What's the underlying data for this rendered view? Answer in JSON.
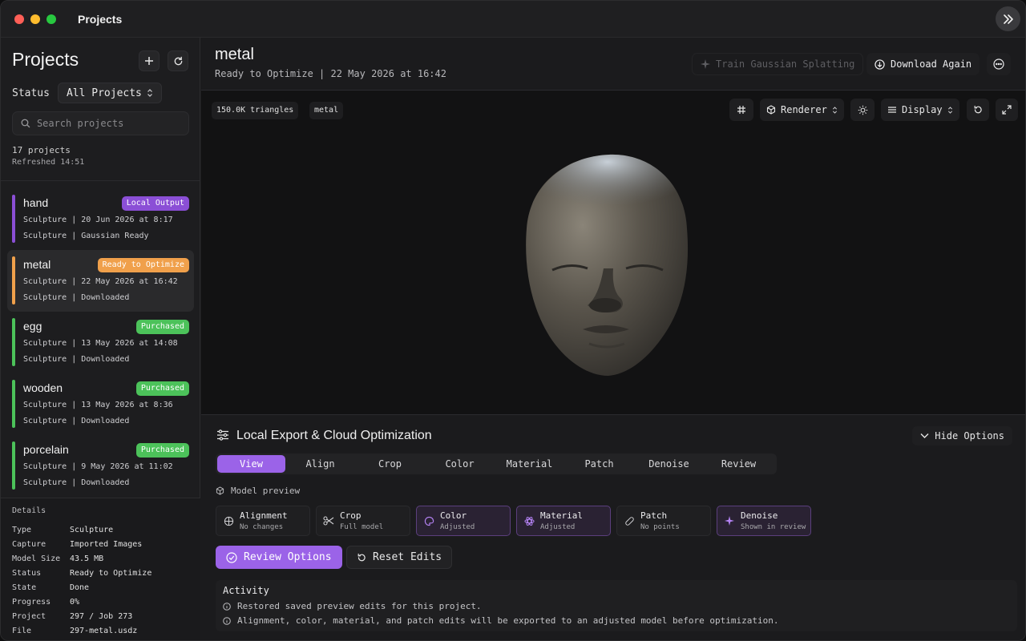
{
  "window": {
    "title": "Projects"
  },
  "sidebar": {
    "title": "Projects",
    "status_label": "Status",
    "status_value": "All Projects",
    "search_placeholder": "Search projects",
    "count": "17 projects",
    "refreshed": "Refreshed 14:51",
    "projects": [
      {
        "name": "hand",
        "badge": "Local Output",
        "badge_color": "#8b4fd6",
        "bar_color": "#8b4fd6",
        "line1": "Sculpture | 20 Jun 2026 at 8:17",
        "line2": "Sculpture | Gaussian Ready"
      },
      {
        "name": "metal",
        "badge": "Ready to Optimize",
        "badge_color": "#f0a04b",
        "bar_color": "#f0a04b",
        "line1": "Sculpture | 22 May 2026 at 16:42",
        "line2": "Sculpture | Downloaded"
      },
      {
        "name": "egg",
        "badge": "Purchased",
        "badge_color": "#4cc25a",
        "bar_color": "#4cc25a",
        "line1": "Sculpture | 13 May 2026 at 14:08",
        "line2": "Sculpture | Downloaded"
      },
      {
        "name": "wooden",
        "badge": "Purchased",
        "badge_color": "#4cc25a",
        "bar_color": "#4cc25a",
        "line1": "Sculpture | 13 May 2026 at 8:36",
        "line2": "Sculpture | Downloaded"
      },
      {
        "name": "porcelain",
        "badge": "Purchased",
        "badge_color": "#4cc25a",
        "bar_color": "#4cc25a",
        "line1": "Sculpture | 9 May 2026 at 11:02",
        "line2": "Sculpture | Downloaded"
      }
    ],
    "details": {
      "heading": "Details",
      "rows": [
        {
          "k": "Type",
          "v": "Sculpture"
        },
        {
          "k": "Capture",
          "v": "Imported Images"
        },
        {
          "k": "Model Size",
          "v": "43.5 MB"
        },
        {
          "k": "Status",
          "v": "Ready to Optimize"
        },
        {
          "k": "State",
          "v": "Done"
        },
        {
          "k": "Progress",
          "v": "0%"
        },
        {
          "k": "Project",
          "v": "297 / Job 273"
        },
        {
          "k": "File",
          "v": "297-metal.usdz"
        }
      ]
    }
  },
  "main": {
    "title": "metal",
    "subtitle": "Ready to Optimize | 22 May 2026 at 16:42",
    "train_label": "Train Gaussian Splatting",
    "download_label": "Download Again",
    "viewport": {
      "triangles": "150.0K triangles",
      "material_chip": "metal",
      "renderer_label": "Renderer",
      "display_label": "Display"
    },
    "panel": {
      "title": "Local Export & Cloud Optimization",
      "hide_label": "Hide Options",
      "tabs": [
        "View",
        "Align",
        "Crop",
        "Color",
        "Material",
        "Patch",
        "Denoise",
        "Review"
      ],
      "model_preview": "Model preview",
      "cards": [
        {
          "title": "Alignment",
          "sub": "No changes",
          "icon": "crosshair-icon",
          "on": false
        },
        {
          "title": "Crop",
          "sub": "Full model",
          "icon": "scissors-icon",
          "on": false
        },
        {
          "title": "Color",
          "sub": "Adjusted",
          "icon": "palette-icon",
          "on": true
        },
        {
          "title": "Material",
          "sub": "Adjusted",
          "icon": "atom-icon",
          "on": true
        },
        {
          "title": "Patch",
          "sub": "No points",
          "icon": "bandage-icon",
          "on": false
        },
        {
          "title": "Denoise",
          "sub": "Shown in review",
          "icon": "sparkle-icon",
          "on": true
        }
      ],
      "review_label": "Review Options",
      "reset_label": "Reset Edits",
      "activity_title": "Activity",
      "activity": [
        "Restored saved preview edits for this project.",
        "Alignment, color, material, and patch edits will be exported to an adjusted model before optimization."
      ]
    }
  },
  "colors": {
    "accent": "#9b63e8"
  }
}
